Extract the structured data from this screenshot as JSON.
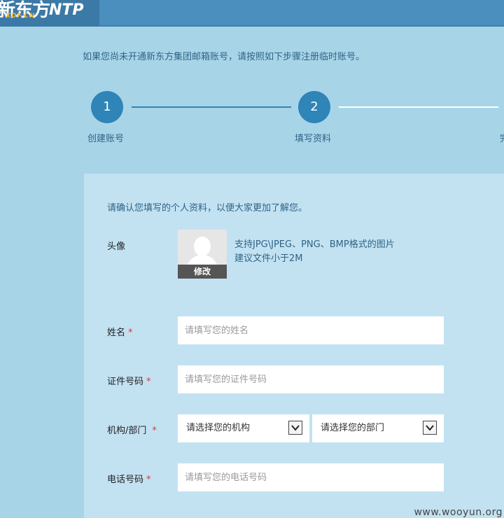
{
  "header": {
    "logo_text": "新东方",
    "logo_sub": "XDF.CN",
    "product": "NTP",
    "brand_color": "#4a8fbe"
  },
  "intro_text": "如果您尚未开通新东方集团邮箱账号，请按照如下步骤注册临时账号。",
  "steps": [
    {
      "number": "1",
      "label": "创建账号"
    },
    {
      "number": "2",
      "label": "填写资料"
    },
    {
      "number": "",
      "label": "完"
    }
  ],
  "form": {
    "note": "请确认您填写的个人资料，以便大家更加了解您。",
    "avatar": {
      "label": "头像",
      "edit_label": "修改",
      "hint_line1": "支持JPG\\JPEG、PNG、BMP格式的图片",
      "hint_line2": "建议文件小于2M"
    },
    "required_mark": "*",
    "name": {
      "label": "姓名",
      "placeholder": "请填写您的姓名"
    },
    "id_number": {
      "label": "证件号码",
      "placeholder": "请填写您的证件号码"
    },
    "org_dept": {
      "label": "机构/部门",
      "org_value": "请选择您的机构",
      "dept_value": "请选择您的部门"
    },
    "phone": {
      "label": "电话号码",
      "placeholder": "请填写您的电话号码"
    }
  },
  "watermark": "www.wooyun.org",
  "colors": {
    "step_active": "#2f84b8",
    "required": "#d23a3a",
    "panel_bg": "#c2e2f2"
  }
}
